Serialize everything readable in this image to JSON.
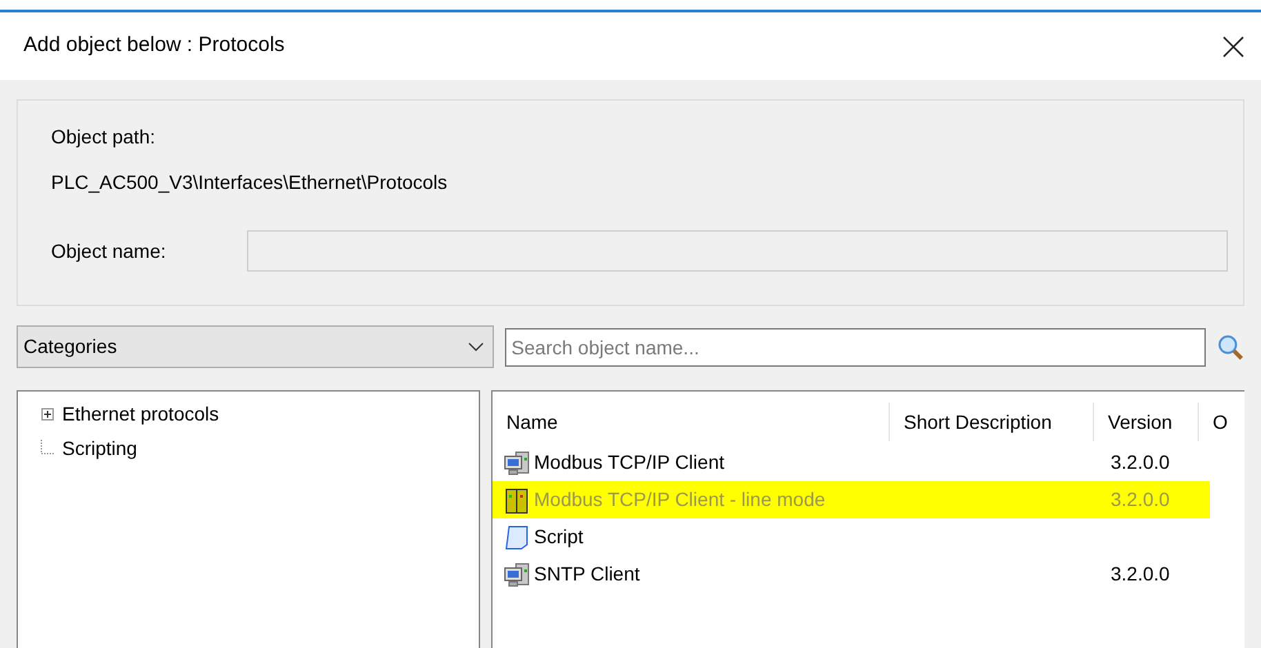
{
  "window": {
    "title": "Add object below : Protocols"
  },
  "object_path": {
    "label": "Object path:",
    "value": "PLC_AC500_V3\\Interfaces\\Ethernet\\Protocols"
  },
  "object_name": {
    "label": "Object name:",
    "disabled": true
  },
  "categories": {
    "value": "Categories"
  },
  "search": {
    "placeholder": "Search object name..."
  },
  "tree": {
    "items": [
      {
        "label": "Ethernet protocols",
        "kind": "collapsed"
      },
      {
        "label": "Scripting",
        "kind": "leaf"
      }
    ]
  },
  "table": {
    "columns": [
      "Name",
      "Short Description",
      "Version",
      "O"
    ],
    "rows": [
      {
        "kind": "computer",
        "name": "Modbus TCP/IP Client",
        "version": "3.2.0.0",
        "selected": false,
        "disabled": false
      },
      {
        "kind": "module",
        "name": "Modbus TCP/IP Client - line mode",
        "version": "3.2.0.0",
        "selected": true,
        "disabled": true
      },
      {
        "kind": "script",
        "name": "Script",
        "selected": false,
        "disabled": false
      },
      {
        "kind": "computer",
        "name": "SNTP Client",
        "version": "3.2.0.0",
        "selected": false,
        "disabled": false
      }
    ]
  }
}
